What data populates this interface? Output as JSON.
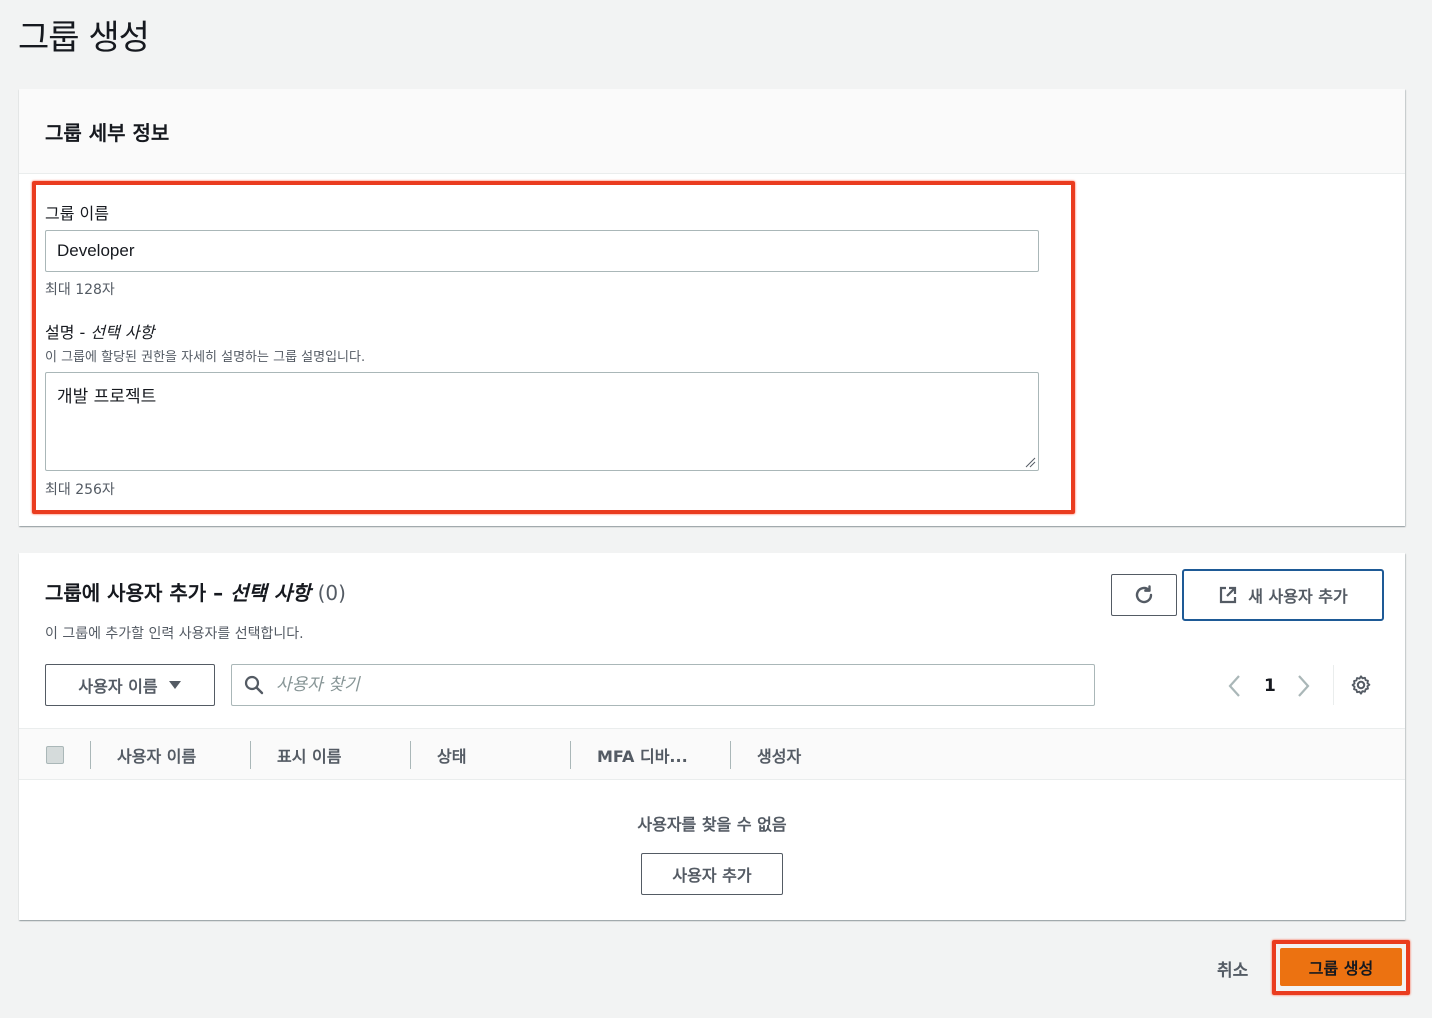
{
  "page": {
    "title": "그룹 생성"
  },
  "details": {
    "title": "그룹 세부 정보",
    "name_label": "그룹 이름",
    "name_value": "Developer",
    "name_constraint": "최대 128자",
    "desc_label": "설명",
    "desc_label_sep": " - ",
    "desc_label_optional": "선택 사항",
    "desc_help": "이 그룹에 할당된 권한을 자세히 설명하는 그룹 설명입니다.",
    "desc_value": "개발 프로젝트",
    "desc_constraint": "최대 256자"
  },
  "users": {
    "title": "그룹에 사용자 추가 – ",
    "title_optional": "선택 사항",
    "count": "(0)",
    "subtitle": "이 그룹에 추가할 인력 사용자를 선택합니다.",
    "refresh_icon": "refresh-icon",
    "new_user_button": "새 사용자 추가",
    "filter_select": "사용자 이름",
    "search_placeholder": "사용자 찾기",
    "page_number": "1",
    "columns": [
      "사용자 이름",
      "표시 이름",
      "상태",
      "MFA 디바...",
      "생성자"
    ],
    "empty_text": "사용자를 찾을 수 없음",
    "add_user_button": "사용자 추가"
  },
  "footer": {
    "cancel": "취소",
    "create": "그룹 생성"
  },
  "colors": {
    "primary": "#ec7211",
    "highlight": "#ea3c1f",
    "focus_border": "#1e5a96"
  }
}
